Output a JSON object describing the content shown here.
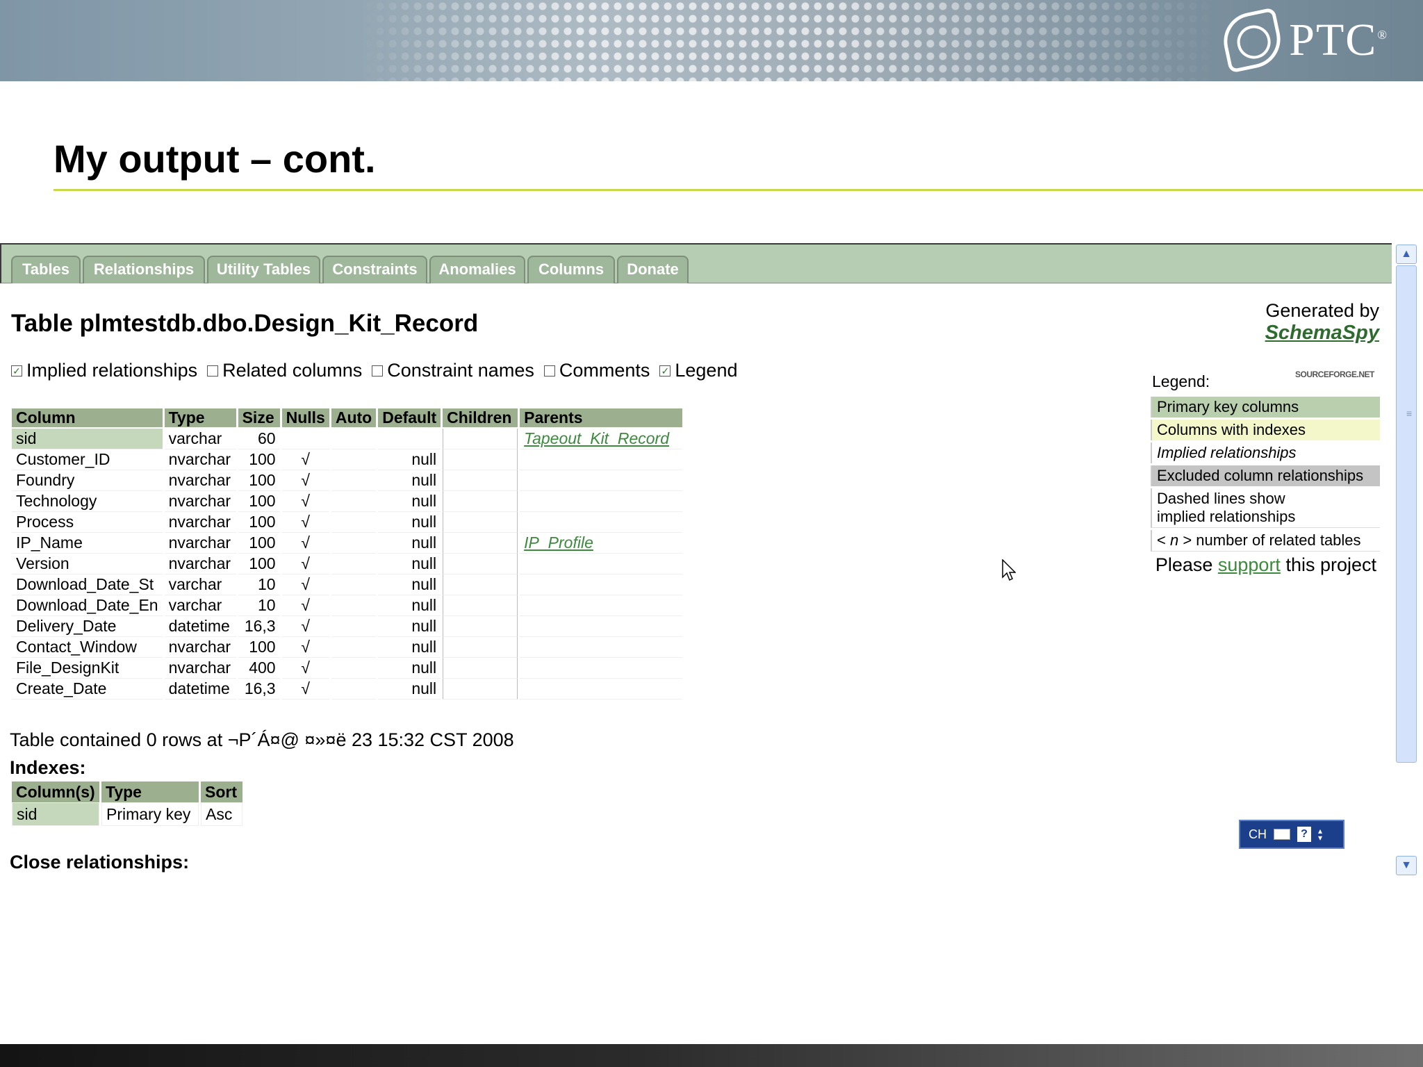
{
  "banner": {
    "logo_text": "PTC",
    "logo_mark": "®"
  },
  "slide": {
    "title": "My output – cont."
  },
  "tabs": [
    "Tables",
    "Relationships",
    "Utility Tables",
    "Constraints",
    "Anomalies",
    "Columns",
    "Donate"
  ],
  "table_heading": "Table plmtestdb.dbo.Design_Kit_Record",
  "options": [
    {
      "label": "Implied relationships",
      "checked": true
    },
    {
      "label": "Related columns",
      "checked": false
    },
    {
      "label": "Constraint names",
      "checked": false
    },
    {
      "label": "Comments",
      "checked": false
    },
    {
      "label": "Legend",
      "checked": true
    }
  ],
  "columns_table": {
    "headers": [
      "Column",
      "Type",
      "Size",
      "Nulls",
      "Auto",
      "Default",
      "Children",
      "Parents"
    ],
    "rows": [
      [
        "sid",
        "varchar",
        "60",
        "",
        "",
        "",
        "",
        "Tapeout_Kit_Record"
      ],
      [
        "Customer_ID",
        "nvarchar",
        "100",
        "√",
        "",
        "null",
        "",
        ""
      ],
      [
        "Foundry",
        "nvarchar",
        "100",
        "√",
        "",
        "null",
        "",
        ""
      ],
      [
        "Technology",
        "nvarchar",
        "100",
        "√",
        "",
        "null",
        "",
        ""
      ],
      [
        "Process",
        "nvarchar",
        "100",
        "√",
        "",
        "null",
        "",
        ""
      ],
      [
        "IP_Name",
        "nvarchar",
        "100",
        "√",
        "",
        "null",
        "",
        "IP_Profile"
      ],
      [
        "Version",
        "nvarchar",
        "100",
        "√",
        "",
        "null",
        "",
        ""
      ],
      [
        "Download_Date_St",
        "varchar",
        "10",
        "√",
        "",
        "null",
        "",
        ""
      ],
      [
        "Download_Date_En",
        "varchar",
        "10",
        "√",
        "",
        "null",
        "",
        ""
      ],
      [
        "Delivery_Date",
        "datetime",
        "16,3",
        "√",
        "",
        "null",
        "",
        ""
      ],
      [
        "Contact_Window",
        "nvarchar",
        "100",
        "√",
        "",
        "null",
        "",
        ""
      ],
      [
        "File_DesignKit",
        "nvarchar",
        "400",
        "√",
        "",
        "null",
        "",
        ""
      ],
      [
        "Create_Date",
        "datetime",
        "16,3",
        "√",
        "",
        "null",
        "",
        ""
      ]
    ]
  },
  "rows_info": "Table contained 0 rows at ¬P´Á¤@ ¤»¤ë 23 15:32 CST 2008",
  "indexes": {
    "heading": "Indexes:",
    "headers": [
      "Column(s)",
      "Type",
      "Sort"
    ],
    "rows": [
      [
        "sid",
        "Primary key",
        "Asc"
      ]
    ]
  },
  "close_relationships": "Close relationships:",
  "generated": {
    "label": "Generated by",
    "link": "SchemaSpy"
  },
  "legend": {
    "label": "Legend:",
    "badge": "SOURCEFORGE.NET",
    "items": {
      "pk": "Primary key columns",
      "idx": "Columns with indexes",
      "imp": "Implied relationships",
      "exc": "Excluded column relationships",
      "dash1": "Dashed lines show",
      "dash2": "implied relationships",
      "n_pre": "< ",
      "n_var": "n",
      "n_post": " > number of related tables"
    }
  },
  "support": {
    "pre": "Please ",
    "link": "support",
    "post": " this project"
  },
  "lang_bar": {
    "code": "CH",
    "help": "?"
  },
  "colors": {
    "header_bg": "#9cb090",
    "pk_bg": "#c6d8bc",
    "tab_bg": "#9fb79a",
    "link": "#3c8a3c",
    "rule": "#c9d84a"
  }
}
